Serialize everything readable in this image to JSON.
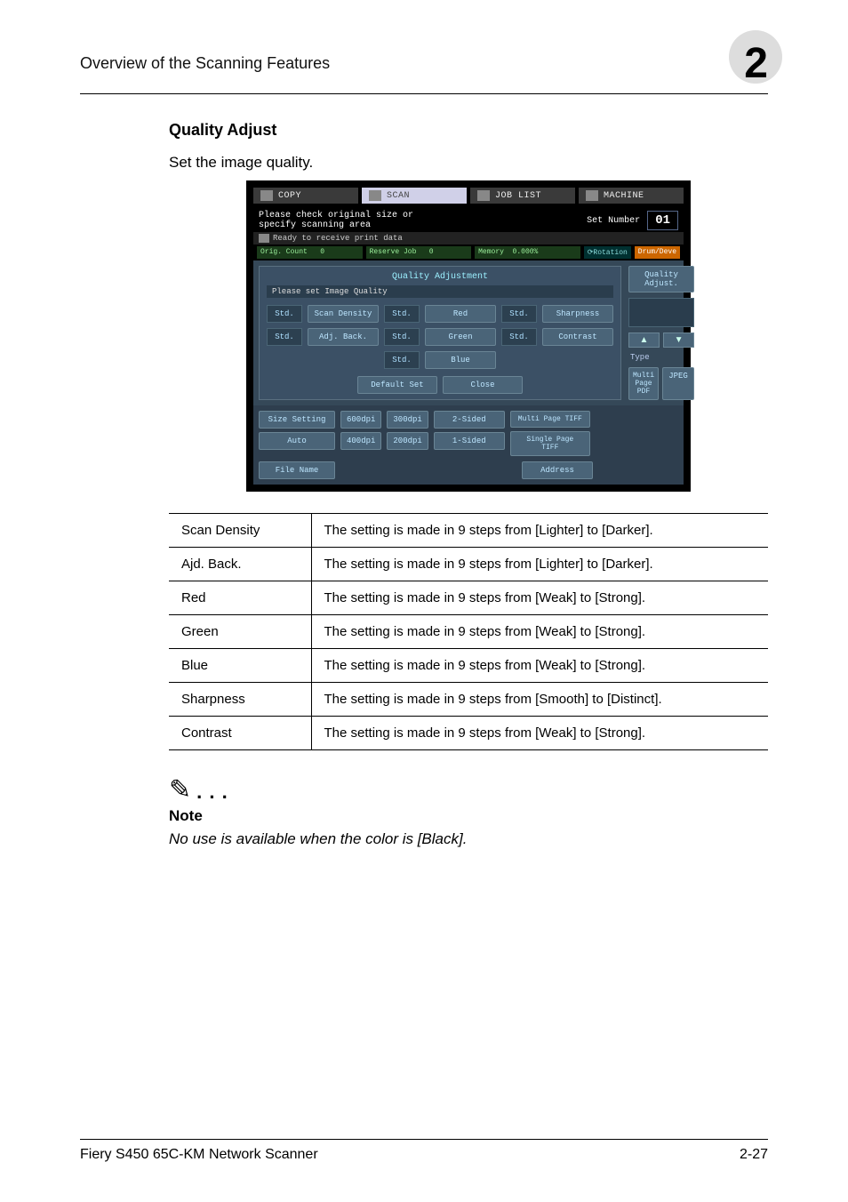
{
  "header": {
    "title": "Overview of the Scanning Features",
    "chapter": "2"
  },
  "section": {
    "title": "Quality Adjust",
    "intro": "Set the image quality."
  },
  "screenshot": {
    "tabs": {
      "copy": "COPY",
      "scan": "SCAN",
      "joblist": "JOB LIST",
      "machine": "MACHINE"
    },
    "info": {
      "prompt_line1": "Please check original size or",
      "prompt_line2": "specify scanning area",
      "setnum_label": "Set Number",
      "setnum_value": "01",
      "status": "Ready to receive print data"
    },
    "meters": {
      "orig_count_label": "Orig. Count",
      "orig_count_value": "0",
      "reserve_job_label": "Reserve Job",
      "reserve_job_value": "0",
      "memory_label": "Memory",
      "memory_value": "0.000%",
      "rotation": "Rotation",
      "drum": "Drum/Deve"
    },
    "body": {
      "header": "Quality Adjustment",
      "hint": "Please set Image Quality",
      "std": "Std.",
      "buttons": {
        "scan_density": "Scan Density",
        "adj_back": "Adj. Back.",
        "red": "Red",
        "green": "Green",
        "blue": "Blue",
        "sharpness": "Sharpness",
        "contrast": "Contrast"
      },
      "default_set": "Default Set",
      "close": "Close"
    },
    "side": {
      "quality_adjust": "Quality Adjust.",
      "type": "Type",
      "multi_pdf": "Multi Page PDF",
      "jpeg": "JPEG"
    },
    "footer": {
      "size_setting": "Size Setting",
      "auto": "Auto",
      "dpi600": "600dpi",
      "dpi400": "400dpi",
      "dpi300": "300dpi",
      "dpi200": "200dpi",
      "sided2": "2-Sided",
      "sided1": "1-Sided",
      "multi_tiff": "Multi Page TIFF",
      "single_tiff": "Single Page TIFF",
      "file_name": "File Name",
      "address": "Address"
    }
  },
  "table": {
    "rows": [
      {
        "name": "Scan Density",
        "desc": "The setting is made in 9 steps from [Lighter] to [Darker]."
      },
      {
        "name": "Ajd. Back.",
        "desc": "The setting is made in 9 steps from [Lighter] to [Darker]."
      },
      {
        "name": "Red",
        "desc": "The setting is made in 9 steps from [Weak] to [Strong]."
      },
      {
        "name": "Green",
        "desc": "The setting is made in 9 steps from [Weak] to [Strong]."
      },
      {
        "name": "Blue",
        "desc": "The setting is made in 9 steps from [Weak] to [Strong]."
      },
      {
        "name": "Sharpness",
        "desc": "The setting is made in 9 steps from [Smooth] to [Distinct]."
      },
      {
        "name": "Contrast",
        "desc": "The setting is made in 9 steps from [Weak] to [Strong]."
      }
    ]
  },
  "note": {
    "label": "Note",
    "text": "No use is available when the color is [Black]."
  },
  "footer": {
    "product": "Fiery S450 65C-KM Network Scanner",
    "page": "2-27"
  }
}
